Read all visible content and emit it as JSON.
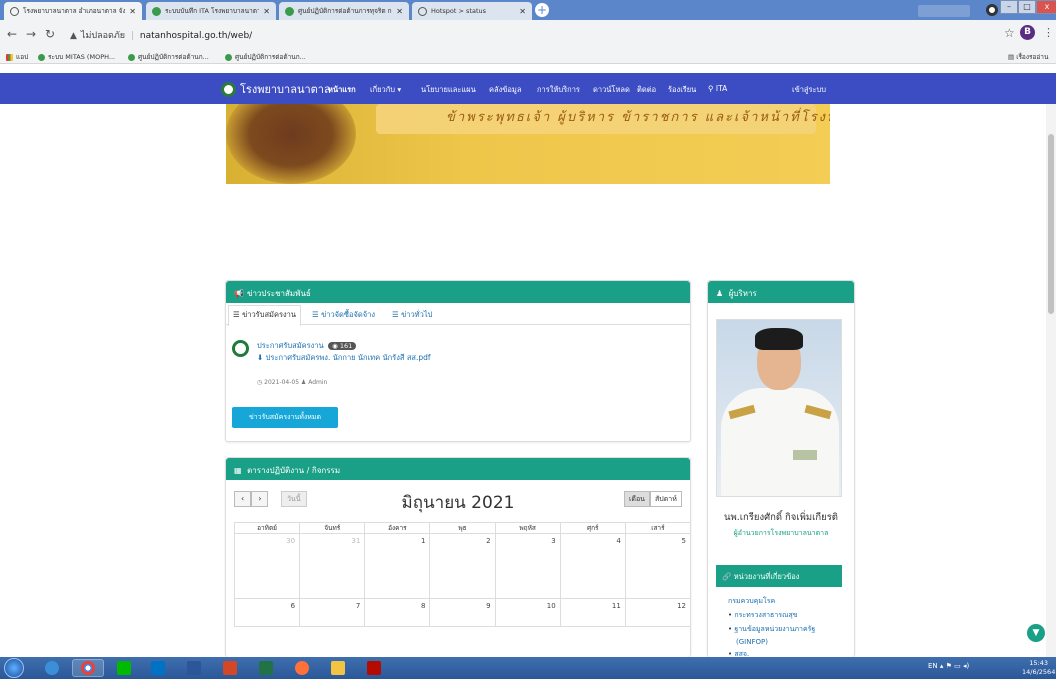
{
  "browser": {
    "tabs": [
      {
        "title": "โรงพยาบาลนาตาล อำเภอนาตาล จังห",
        "icon": "globe-icon"
      },
      {
        "title": "ระบบบันทึก ITA โรงพยาบาลนาตาล จั",
        "icon": "puzzle-icon"
      },
      {
        "title": "ศูนย์ปฏิบัติการต่อต้านการทุจริต กระท",
        "icon": "gov-icon"
      },
      {
        "title": "Hotspot > status",
        "icon": "globe-icon"
      }
    ],
    "new_tab": "+",
    "minimize": "–",
    "maximize": "□",
    "close": "x",
    "security": "ไม่ปลอดภัย",
    "url": "natanhospital.go.th/web/",
    "profile_initial": "B",
    "bookmarks": [
      "แอป",
      "ระบบ MITAS (MOPH...",
      "ศูนย์ปฏิบัติการต่อต้านก...",
      "ศูนย์ปฏิบัติการต่อต้านก..."
    ],
    "reading_list": "เรื่องรออ่าน"
  },
  "site": {
    "name": "โรงพยาบาลนาตาล",
    "menu": [
      "หน้าแรก",
      "เกี่ยวกับ ▾",
      "นโยบายและแผน",
      "คลังข้อมูล",
      "การให้บริการ",
      "ดาวน์โหลด",
      "ติดต่อ",
      "ร้องเรียน",
      "ITA"
    ],
    "login": "เข้าสู่ระบบ",
    "banner_text": "ข้าพระพุทธเจ้า ผู้บริหาร ข้าราชการ และเจ้าหน้าที่โรงพยาบาลนาตาล"
  },
  "news": {
    "header": "ข่าวประชาสัมพันธ์",
    "tabs": [
      "ข่าวรับสมัครงาน",
      "ข่าวจัดซื้อจัดจ้าง",
      "ข่าวทั่วไป"
    ],
    "item_title": "ประกาศรับสมัครงาน",
    "views": "161",
    "file": "ประกาศรับสมัครพง. นักกาย นักเทค นักรังสี สส.pdf",
    "meta": "2021-04-05 ♟ Admin",
    "button": "ข่าวรับสมัครงานทั้งหมด"
  },
  "calendar": {
    "header": "ตารางปฏิบัติงาน / กิจกรรม",
    "prev": "‹",
    "next": "›",
    "today": "วันนี้",
    "title": "มิถุนายน 2021",
    "views": [
      "เดือน",
      "สัปดาห์"
    ],
    "days": [
      "อาทิตย์",
      "จันทร์",
      "อังคาร",
      "พุธ",
      "พฤหัส",
      "ศุกร์",
      "เสาร์"
    ],
    "week1": [
      "30",
      "31",
      "1",
      "2",
      "3",
      "4",
      "5"
    ],
    "week2": [
      "6",
      "7",
      "8",
      "9",
      "10",
      "11",
      "12"
    ]
  },
  "admin": {
    "header": "ผู้บริหาร",
    "name": "นพ.เกรียงศักดิ์ กิจเพิ่มเกียรติ",
    "role": "ผู้อำนวยการโรงพยาบาลนาตาล"
  },
  "related": {
    "header": "หน่วยงานที่เกี่ยวข้อง",
    "first": "กรมควบคุมโรค",
    "items": [
      "กระทรวงสาธารณสุข",
      "ฐานข้อมูลหน่วยงานภาครัฐ",
      "(GINFOP)",
      "สสจ."
    ]
  },
  "taskbar": {
    "lang": "EN",
    "time": "15:43",
    "date": "14/6/2564"
  },
  "colors": {
    "nav": "#3c4dc4",
    "panel_header": "#1aa087",
    "link": "#1a6fb0",
    "button": "#17a6d8"
  }
}
